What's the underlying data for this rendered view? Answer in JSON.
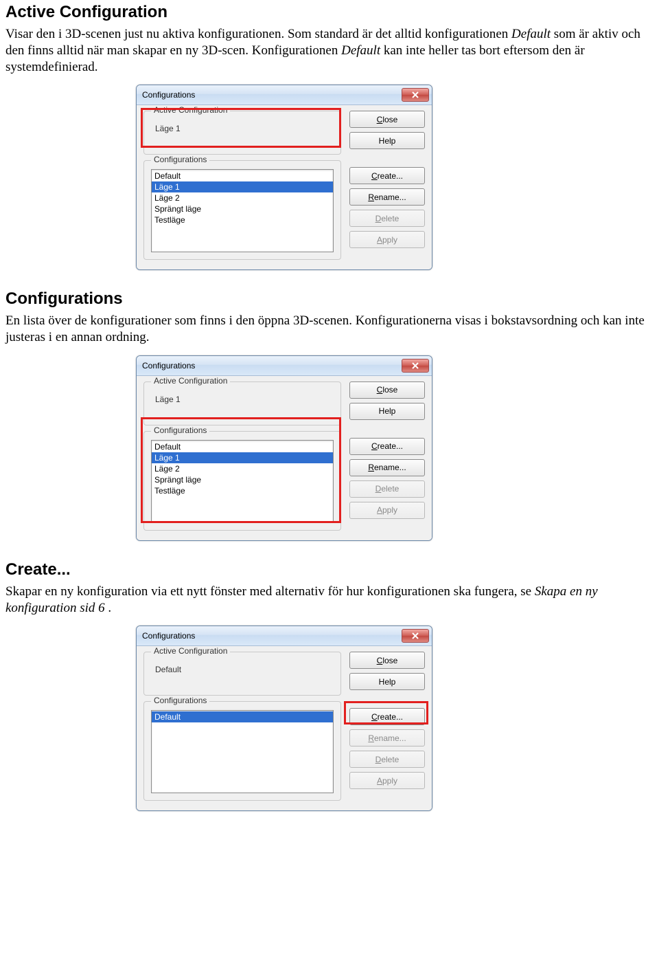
{
  "sections": {
    "s1": {
      "heading": "Active Configuration",
      "p1a": "Visar den i 3D-scenen just nu aktiva konfigurationen. Som standard är det alltid konfigurationen ",
      "p1b": "Default",
      "p1c": " som är aktiv och den finns alltid när man skapar en ny 3D-scen. Konfigurationen ",
      "p1d": "Default",
      "p1e": " kan inte heller tas bort eftersom den är systemdefinierad."
    },
    "s2": {
      "heading": "Configurations",
      "p": "En lista över de konfigurationer som finns i den öppna 3D-scenen. Konfigurationerna visas i bokstavsordning och kan inte justeras i en annan ordning."
    },
    "s3": {
      "heading": "Create...",
      "p1": "Skapar en ny konfiguration via ett nytt fönster med alternativ för hur konfigurationen ska fungera, se ",
      "p1i": "Skapa en ny konfiguration sid 6",
      "p1end": "."
    }
  },
  "dialog": {
    "title": "Configurations",
    "group_active": "Active Configuration",
    "group_list": "Configurations",
    "btn_close_pre": "",
    "btn_close_mn": "C",
    "btn_close_post": "lose",
    "btn_help": "Help",
    "btn_create_mn": "C",
    "btn_create_post": "reate...",
    "btn_rename_mn": "R",
    "btn_rename_post": "ename...",
    "btn_delete_mn": "D",
    "btn_delete_post": "elete",
    "btn_apply_mn": "A",
    "btn_apply_post": "pply"
  },
  "dlg1": {
    "active": "Läge 1",
    "items": [
      "Default",
      "Läge 1",
      "Läge 2",
      "Sprängt läge",
      "Testläge"
    ],
    "selected": "Läge 1",
    "disabled": [
      "delete",
      "apply"
    ]
  },
  "dlg2": {
    "active": "Läge 1",
    "items": [
      "Default",
      "Läge 1",
      "Läge 2",
      "Sprängt läge",
      "Testläge"
    ],
    "selected": "Läge 1",
    "disabled": [
      "delete",
      "apply"
    ]
  },
  "dlg3": {
    "active": "Default",
    "items": [
      "Default"
    ],
    "selected": "Default",
    "disabled": [
      "rename",
      "delete",
      "apply"
    ]
  }
}
